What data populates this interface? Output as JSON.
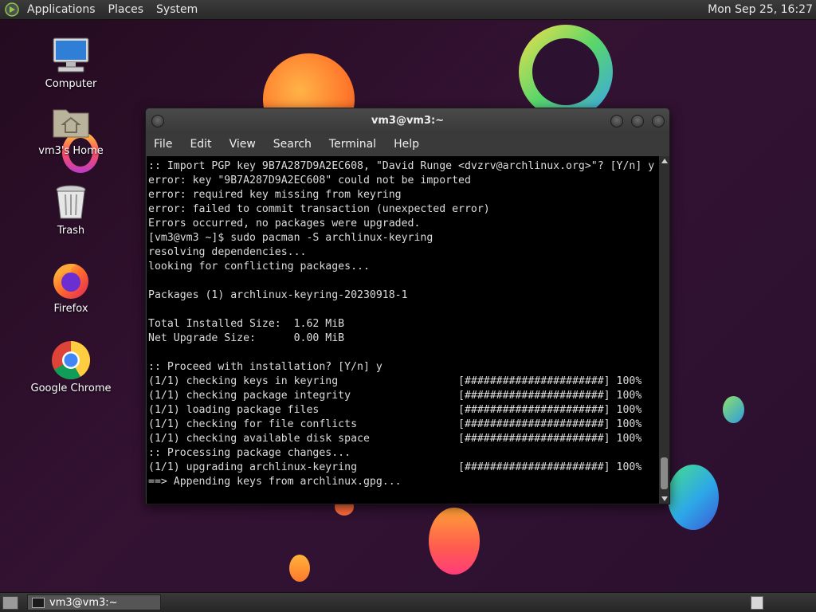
{
  "top_panel": {
    "menus": [
      "Applications",
      "Places",
      "System"
    ],
    "clock": "Mon Sep 25, 16:27"
  },
  "desktop_icons": [
    {
      "label": "Computer",
      "icon": "computer-icon"
    },
    {
      "label": "vm3's Home",
      "icon": "home-folder-icon"
    },
    {
      "label": "Trash",
      "icon": "trash-icon"
    },
    {
      "label": "Firefox",
      "icon": "firefox-icon"
    },
    {
      "label": "Google Chrome",
      "icon": "chrome-icon"
    }
  ],
  "terminal": {
    "title": "vm3@vm3:~",
    "menus": [
      "File",
      "Edit",
      "View",
      "Search",
      "Terminal",
      "Help"
    ],
    "lines": [
      ":: Import PGP key 9B7A287D9A2EC608, \"David Runge <dvzrv@archlinux.org>\"? [Y/n] y",
      "error: key \"9B7A287D9A2EC608\" could not be imported",
      "error: required key missing from keyring",
      "error: failed to commit transaction (unexpected error)",
      "Errors occurred, no packages were upgraded.",
      "[vm3@vm3 ~]$ sudo pacman -S archlinux-keyring",
      "resolving dependencies...",
      "looking for conflicting packages...",
      "",
      "Packages (1) archlinux-keyring-20230918-1",
      "",
      "Total Installed Size:  1.62 MiB",
      "Net Upgrade Size:      0.00 MiB",
      "",
      ":: Proceed with installation? [Y/n] y",
      "(1/1) checking keys in keyring                   [######################] 100%",
      "(1/1) checking package integrity                 [######################] 100%",
      "(1/1) loading package files                      [######################] 100%",
      "(1/1) checking for file conflicts                [######################] 100%",
      "(1/1) checking available disk space              [######################] 100%",
      ":: Processing package changes...",
      "(1/1) upgrading archlinux-keyring                [######################] 100%",
      "==> Appending keys from archlinux.gpg..."
    ]
  },
  "taskbar": {
    "task_label": "vm3@vm3:~"
  },
  "colors": {
    "panel": "#2f2f2f",
    "terminal_bg": "#000000",
    "terminal_fg": "#dcdcdc"
  }
}
